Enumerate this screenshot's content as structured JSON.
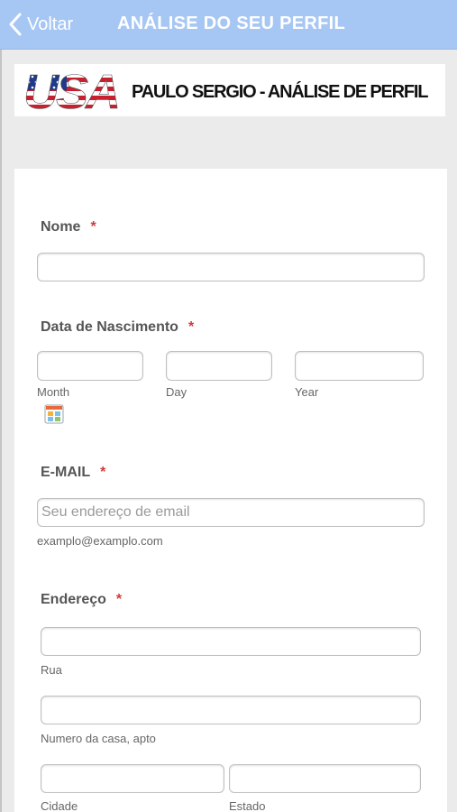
{
  "nav": {
    "back_label": "Voltar",
    "title": "ANÁLISE DO SEU PERFIL",
    "bar_color": "#a6c7f3"
  },
  "banner": {
    "logo_icon": "usa-flag-logo",
    "title": "PAULO SERGIO - ANÁLISE DE PERFIL"
  },
  "form": {
    "required_marker": "*",
    "required_color": "#d23a3a",
    "name": {
      "label": "Nome",
      "value": ""
    },
    "birthdate": {
      "label": "Data de Nascimento",
      "month_caption": "Month",
      "day_caption": "Day",
      "year_caption": "Year",
      "calendar_icon": "calendar-icon"
    },
    "email": {
      "label": "E-MAIL",
      "placeholder": "Seu endereço de email",
      "hint": "examplo@examplo.com"
    },
    "address": {
      "label": "Endereço",
      "street_caption": "Rua",
      "number_caption": "Numero da casa, apto",
      "city_caption": "Cidade",
      "state_caption": "Estado"
    }
  }
}
